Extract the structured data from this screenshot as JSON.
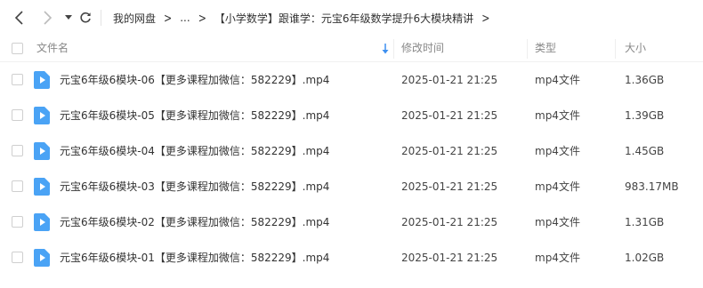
{
  "toolbar": {
    "back_icon": "chevron-left-icon",
    "forward_icon": "chevron-right-icon",
    "history_icon": "caret-down-icon",
    "refresh_icon": "refresh-icon"
  },
  "breadcrumb": {
    "items": [
      "我的网盘",
      "...",
      "【小学数学】跟谁学：元宝6年级数学提升6大模块精讲"
    ],
    "separator": ">"
  },
  "table": {
    "columns": {
      "name": "文件名",
      "modified": "修改时间",
      "type": "类型",
      "size": "大小"
    },
    "sort_icon": "sort-down-arrow-icon",
    "rows": [
      {
        "name": "元宝6年级6模块-06【更多课程加微信：582229】.mp4",
        "modified": "2025-01-21 21:25",
        "type": "mp4文件",
        "size": "1.36GB"
      },
      {
        "name": "元宝6年级6模块-05【更多课程加微信：582229】.mp4",
        "modified": "2025-01-21 21:25",
        "type": "mp4文件",
        "size": "1.39GB"
      },
      {
        "name": "元宝6年级6模块-04【更多课程加微信：582229】.mp4",
        "modified": "2025-01-21 21:25",
        "type": "mp4文件",
        "size": "1.45GB"
      },
      {
        "name": "元宝6年级6模块-03【更多课程加微信：582229】.mp4",
        "modified": "2025-01-21 21:25",
        "type": "mp4文件",
        "size": "983.17MB"
      },
      {
        "name": "元宝6年级6模块-02【更多课程加微信：582229】.mp4",
        "modified": "2025-01-21 21:25",
        "type": "mp4文件",
        "size": "1.31GB"
      },
      {
        "name": "元宝6年级6模块-01【更多课程加微信：582229】.mp4",
        "modified": "2025-01-21 21:25",
        "type": "mp4文件",
        "size": "1.02GB"
      }
    ]
  },
  "colors": {
    "accent": "#3d8ff0",
    "video_icon": "#4aa3f5",
    "header_text": "#888888"
  }
}
